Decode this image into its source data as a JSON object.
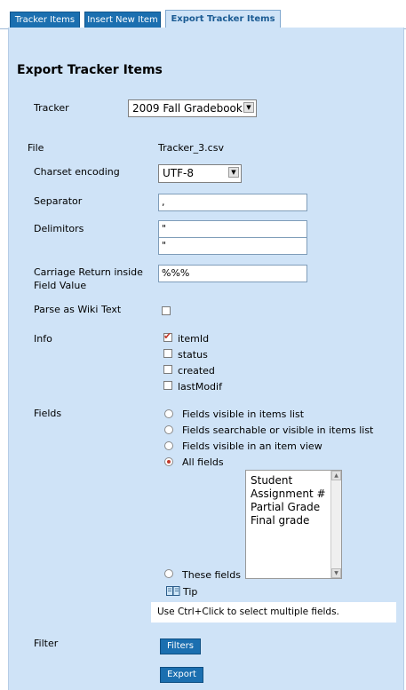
{
  "tabs": [
    {
      "label": "Tracker Items"
    },
    {
      "label": "Insert New Item"
    },
    {
      "label": "Export Tracker Items"
    }
  ],
  "page_title": "Export Tracker Items",
  "form": {
    "tracker": {
      "label": "Tracker",
      "value": "2009 Fall Gradebook"
    },
    "file": {
      "label": "File",
      "value": "Tracker_3.csv"
    },
    "charset": {
      "label": "Charset encoding",
      "value": "UTF-8"
    },
    "separator": {
      "label": "Separator",
      "value": ","
    },
    "delimitors": {
      "label": "Delimitors",
      "value1": "\"",
      "value2": "\""
    },
    "carriage": {
      "label_line1": "Carriage Return inside",
      "label_line2": "Field Value",
      "value": "%%%"
    },
    "parse_wiki": {
      "label": "Parse as Wiki Text",
      "checked": false
    },
    "info": {
      "label": "Info",
      "options": [
        {
          "label": "itemId",
          "checked": true
        },
        {
          "label": "status",
          "checked": false
        },
        {
          "label": "created",
          "checked": false
        },
        {
          "label": "lastModif",
          "checked": false
        }
      ]
    },
    "fields": {
      "label": "Fields",
      "options": [
        {
          "label": "Fields visible in items list",
          "selected": false
        },
        {
          "label": "Fields searchable or visible in items list",
          "selected": false
        },
        {
          "label": "Fields visible in an item view",
          "selected": false
        },
        {
          "label": "All fields",
          "selected": true
        },
        {
          "label": "These fields",
          "selected": false
        }
      ],
      "list_items": [
        "Student",
        "Assignment #",
        "Partial Grade",
        "Final grade"
      ],
      "tip_label": "Tip",
      "tip_text": "Use Ctrl+Click to select multiple fields."
    },
    "filter": {
      "label": "Filter",
      "button": "Filters"
    },
    "export_button": "Export"
  },
  "colors": {
    "panel_bg": "#cfe3f7",
    "button_bg": "#1b6fb0",
    "checked_mark": "#c0392b"
  }
}
